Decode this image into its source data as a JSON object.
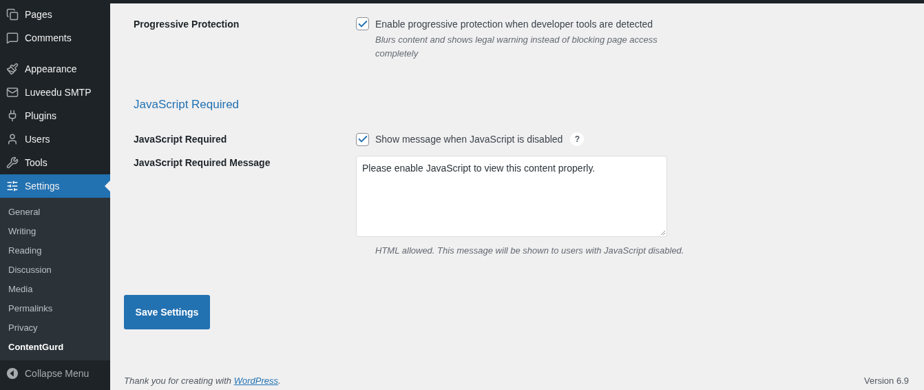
{
  "sidebar": {
    "menu_groups": [
      [
        {
          "label": "Pages",
          "selected": false
        },
        {
          "label": "Comments",
          "selected": false
        }
      ],
      [
        {
          "label": "Appearance",
          "selected": false
        },
        {
          "label": "Luveedu SMTP",
          "selected": false
        },
        {
          "label": "Plugins",
          "selected": false
        },
        {
          "label": "Users",
          "selected": false
        },
        {
          "label": "Tools",
          "selected": false
        },
        {
          "label": "Settings",
          "selected": true
        }
      ]
    ],
    "submenu": [
      {
        "label": "General",
        "selected": false
      },
      {
        "label": "Writing",
        "selected": false
      },
      {
        "label": "Reading",
        "selected": false
      },
      {
        "label": "Discussion",
        "selected": false
      },
      {
        "label": "Media",
        "selected": false
      },
      {
        "label": "Permalinks",
        "selected": false
      },
      {
        "label": "Privacy",
        "selected": false
      },
      {
        "label": "ContentGurd",
        "selected": true
      }
    ],
    "collapse": "Collapse Menu"
  },
  "fields": [
    {
      "kind": "checkbox",
      "label": "Progressive Protection",
      "checked": true,
      "option": "Enable progressive protection when developer tools are detected",
      "description": "Blurs content and shows legal warning instead of blocking page access completely"
    },
    {
      "kind": "heading",
      "title": "JavaScript Required"
    },
    {
      "kind": "checkbox",
      "label": "JavaScript Required",
      "checked": true,
      "option": "Show message when JavaScript is disabled",
      "help": "?"
    },
    {
      "kind": "textarea",
      "label": "JavaScript Required Message",
      "value": "Please enable JavaScript to view this content properly.",
      "description": "HTML allowed. This message will be shown to users with JavaScript disabled."
    }
  ],
  "save_button": "Save Settings",
  "footer": {
    "text": "Thank you for creating with ",
    "link": "WordPress",
    "after": "."
  },
  "version": "Version 6.9"
}
